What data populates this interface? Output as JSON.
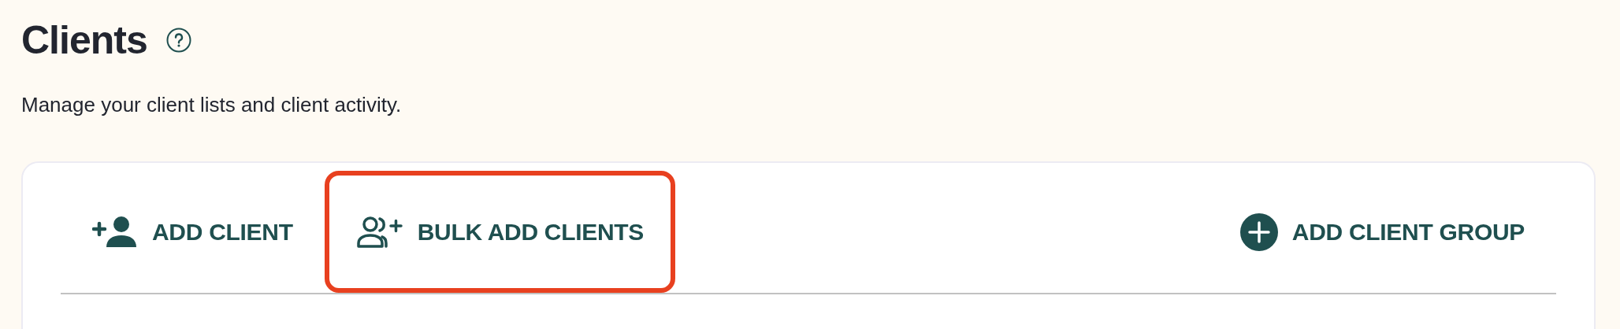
{
  "page": {
    "title": "Clients",
    "subtitle": "Manage your client lists and client activity."
  },
  "actions": [
    {
      "kind": "add-client",
      "label": "ADD CLIENT",
      "highlighted": false
    },
    {
      "kind": "bulk-add",
      "label": "BULK ADD CLIENTS",
      "highlighted": true
    },
    {
      "kind": "add-group",
      "label": "ADD CLIENT GROUP",
      "highlighted": false
    }
  ]
}
